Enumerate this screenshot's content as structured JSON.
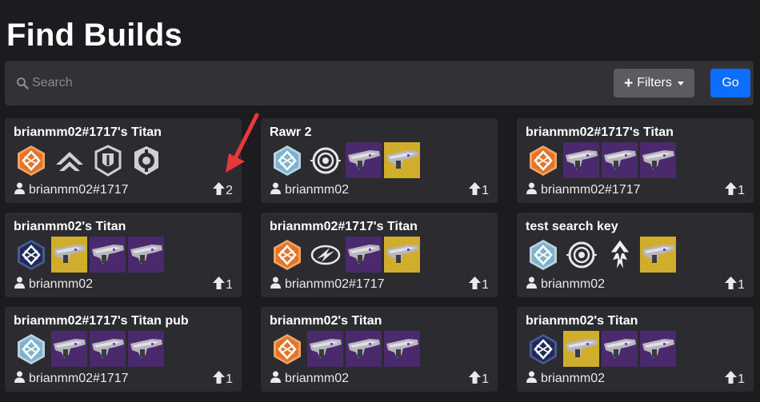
{
  "header": {
    "title": "Find Builds"
  },
  "search": {
    "placeholder": "Search",
    "value": "",
    "filters_label": "Filters",
    "go_label": "Go"
  },
  "builds": [
    {
      "name": "brianmm02#1717's Titan",
      "author": "brianmm02#1717",
      "votes": "2",
      "icons": [
        "class-solar-icon",
        "armor-ornament-icon",
        "shield-aspect-icon",
        "gear-aspect-icon"
      ]
    },
    {
      "name": "Rawr 2",
      "author": "brianmm02",
      "votes": "1",
      "icons": [
        "class-arc-icon",
        "ring-aspect-icon",
        "weapon-purple-icon",
        "weapon-gold-icon"
      ]
    },
    {
      "name": "brianmm02#1717's Titan",
      "author": "brianmm02#1717",
      "votes": "1",
      "icons": [
        "class-solar-icon",
        "weapon-purple-icon",
        "weapon-purple-icon",
        "weapon-purple-icon"
      ]
    },
    {
      "name": "brianmm02's Titan",
      "author": "brianmm02",
      "votes": "1",
      "icons": [
        "class-void-icon",
        "weapon-gold-icon",
        "weapon-purple-icon",
        "weapon-purple-icon"
      ]
    },
    {
      "name": "brianmm02#1717's Titan",
      "author": "brianmm02#1717",
      "votes": "1",
      "icons": [
        "class-solar-icon",
        "speed-aspect-icon",
        "weapon-purple-icon",
        "weapon-gold-icon"
      ]
    },
    {
      "name": "test search key",
      "author": "brianmm02",
      "votes": "1",
      "icons": [
        "class-arc-icon",
        "ring-aspect-icon",
        "fireball-aspect-icon",
        "weapon-gold-icon"
      ]
    },
    {
      "name": "brianmm02#1717's Titan pub",
      "author": "brianmm02#1717",
      "votes": "1",
      "icons": [
        "class-arc-icon",
        "weapon-purple-icon",
        "weapon-purple-icon",
        "weapon-purple-icon"
      ]
    },
    {
      "name": "brianmm02's Titan",
      "author": "brianmm02",
      "votes": "1",
      "icons": [
        "class-solar-icon",
        "weapon-purple-icon",
        "weapon-purple-icon",
        "weapon-purple-icon"
      ]
    },
    {
      "name": "brianmm02's Titan",
      "author": "brianmm02",
      "votes": "1",
      "icons": [
        "class-void-icon",
        "weapon-gold-icon",
        "weapon-purple-icon",
        "weapon-purple-icon"
      ]
    }
  ],
  "colors": {
    "background": "#1c1c20",
    "card": "#2b2b30",
    "go_button": "#0d6efd",
    "filters_button": "#5a5c60",
    "solar": "#e2752a",
    "arc": "#7fb2cc",
    "void": "#1e2a5a",
    "rare_purple": "#4a2a6c",
    "exotic_gold": "#d0ad2a",
    "annotation_arrow": "#e8383a"
  }
}
